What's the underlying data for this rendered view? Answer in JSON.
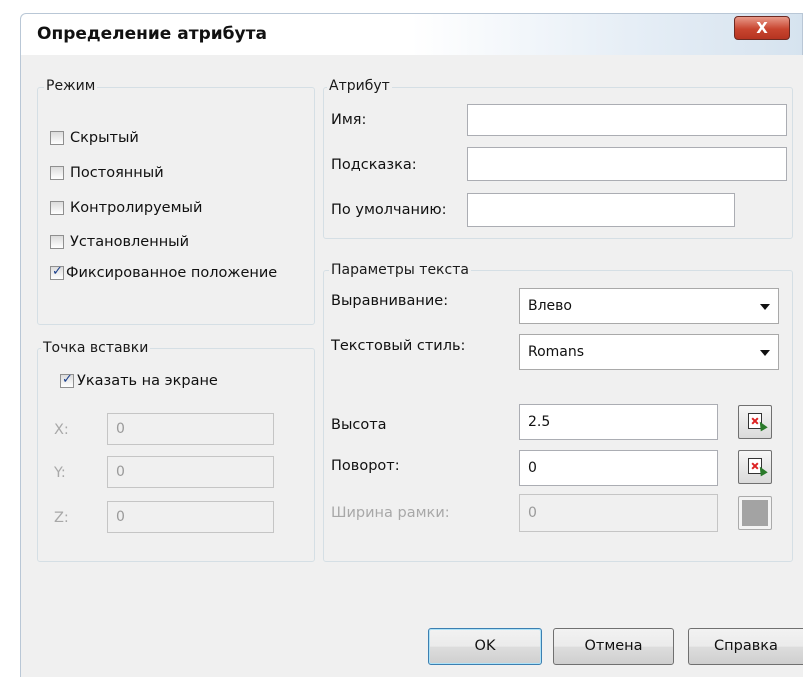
{
  "dialog": {
    "title": "Определение атрибута",
    "close_glyph": "X"
  },
  "mode": {
    "legend": "Режим",
    "checkboxes": [
      {
        "label": "Скрытый",
        "checked": false
      },
      {
        "label": "Постоянный",
        "checked": false
      },
      {
        "label": "Контролируемый",
        "checked": false
      },
      {
        "label": "Установленный",
        "checked": false
      },
      {
        "label": "Фиксированное положение",
        "checked": true
      }
    ]
  },
  "insertion_point": {
    "legend": "Точка вставки",
    "specify_on_screen": {
      "label": "Указать на экране",
      "checked": true
    },
    "x": {
      "label": "X:",
      "value": "0"
    },
    "y": {
      "label": "Y:",
      "value": "0"
    },
    "z": {
      "label": "Z:",
      "value": "0"
    }
  },
  "attribute": {
    "legend": "Атрибут",
    "name": {
      "label": "Имя:",
      "value": ""
    },
    "prompt": {
      "label": "Подсказка:",
      "value": ""
    },
    "default": {
      "label": "По умолчанию:",
      "value": ""
    }
  },
  "text_params": {
    "legend": "Параметры текста",
    "justification": {
      "label": "Выравнивание:",
      "value": "Влево"
    },
    "text_style": {
      "label": "Текстовый стиль:",
      "value": "Romans"
    },
    "height": {
      "label": "Высота",
      "value": "2.5"
    },
    "rotation": {
      "label": "Поворот:",
      "value": "0"
    },
    "boundary_width": {
      "label": "Ширина рамки:",
      "value": "0",
      "enabled": false
    }
  },
  "buttons": {
    "ok": "OK",
    "cancel": "Отмена",
    "help": "Справка"
  },
  "icons": {
    "close": "close-icon",
    "pick": "pick-point-icon",
    "dropdown": "chevron-down-icon",
    "check": "checkmark-icon"
  },
  "colors": {
    "dialog_bg": "#f0f0f0",
    "close_button": "#c8452f",
    "checkmark": "#1b3f8b",
    "disabled_text": "#a8a8a8"
  }
}
